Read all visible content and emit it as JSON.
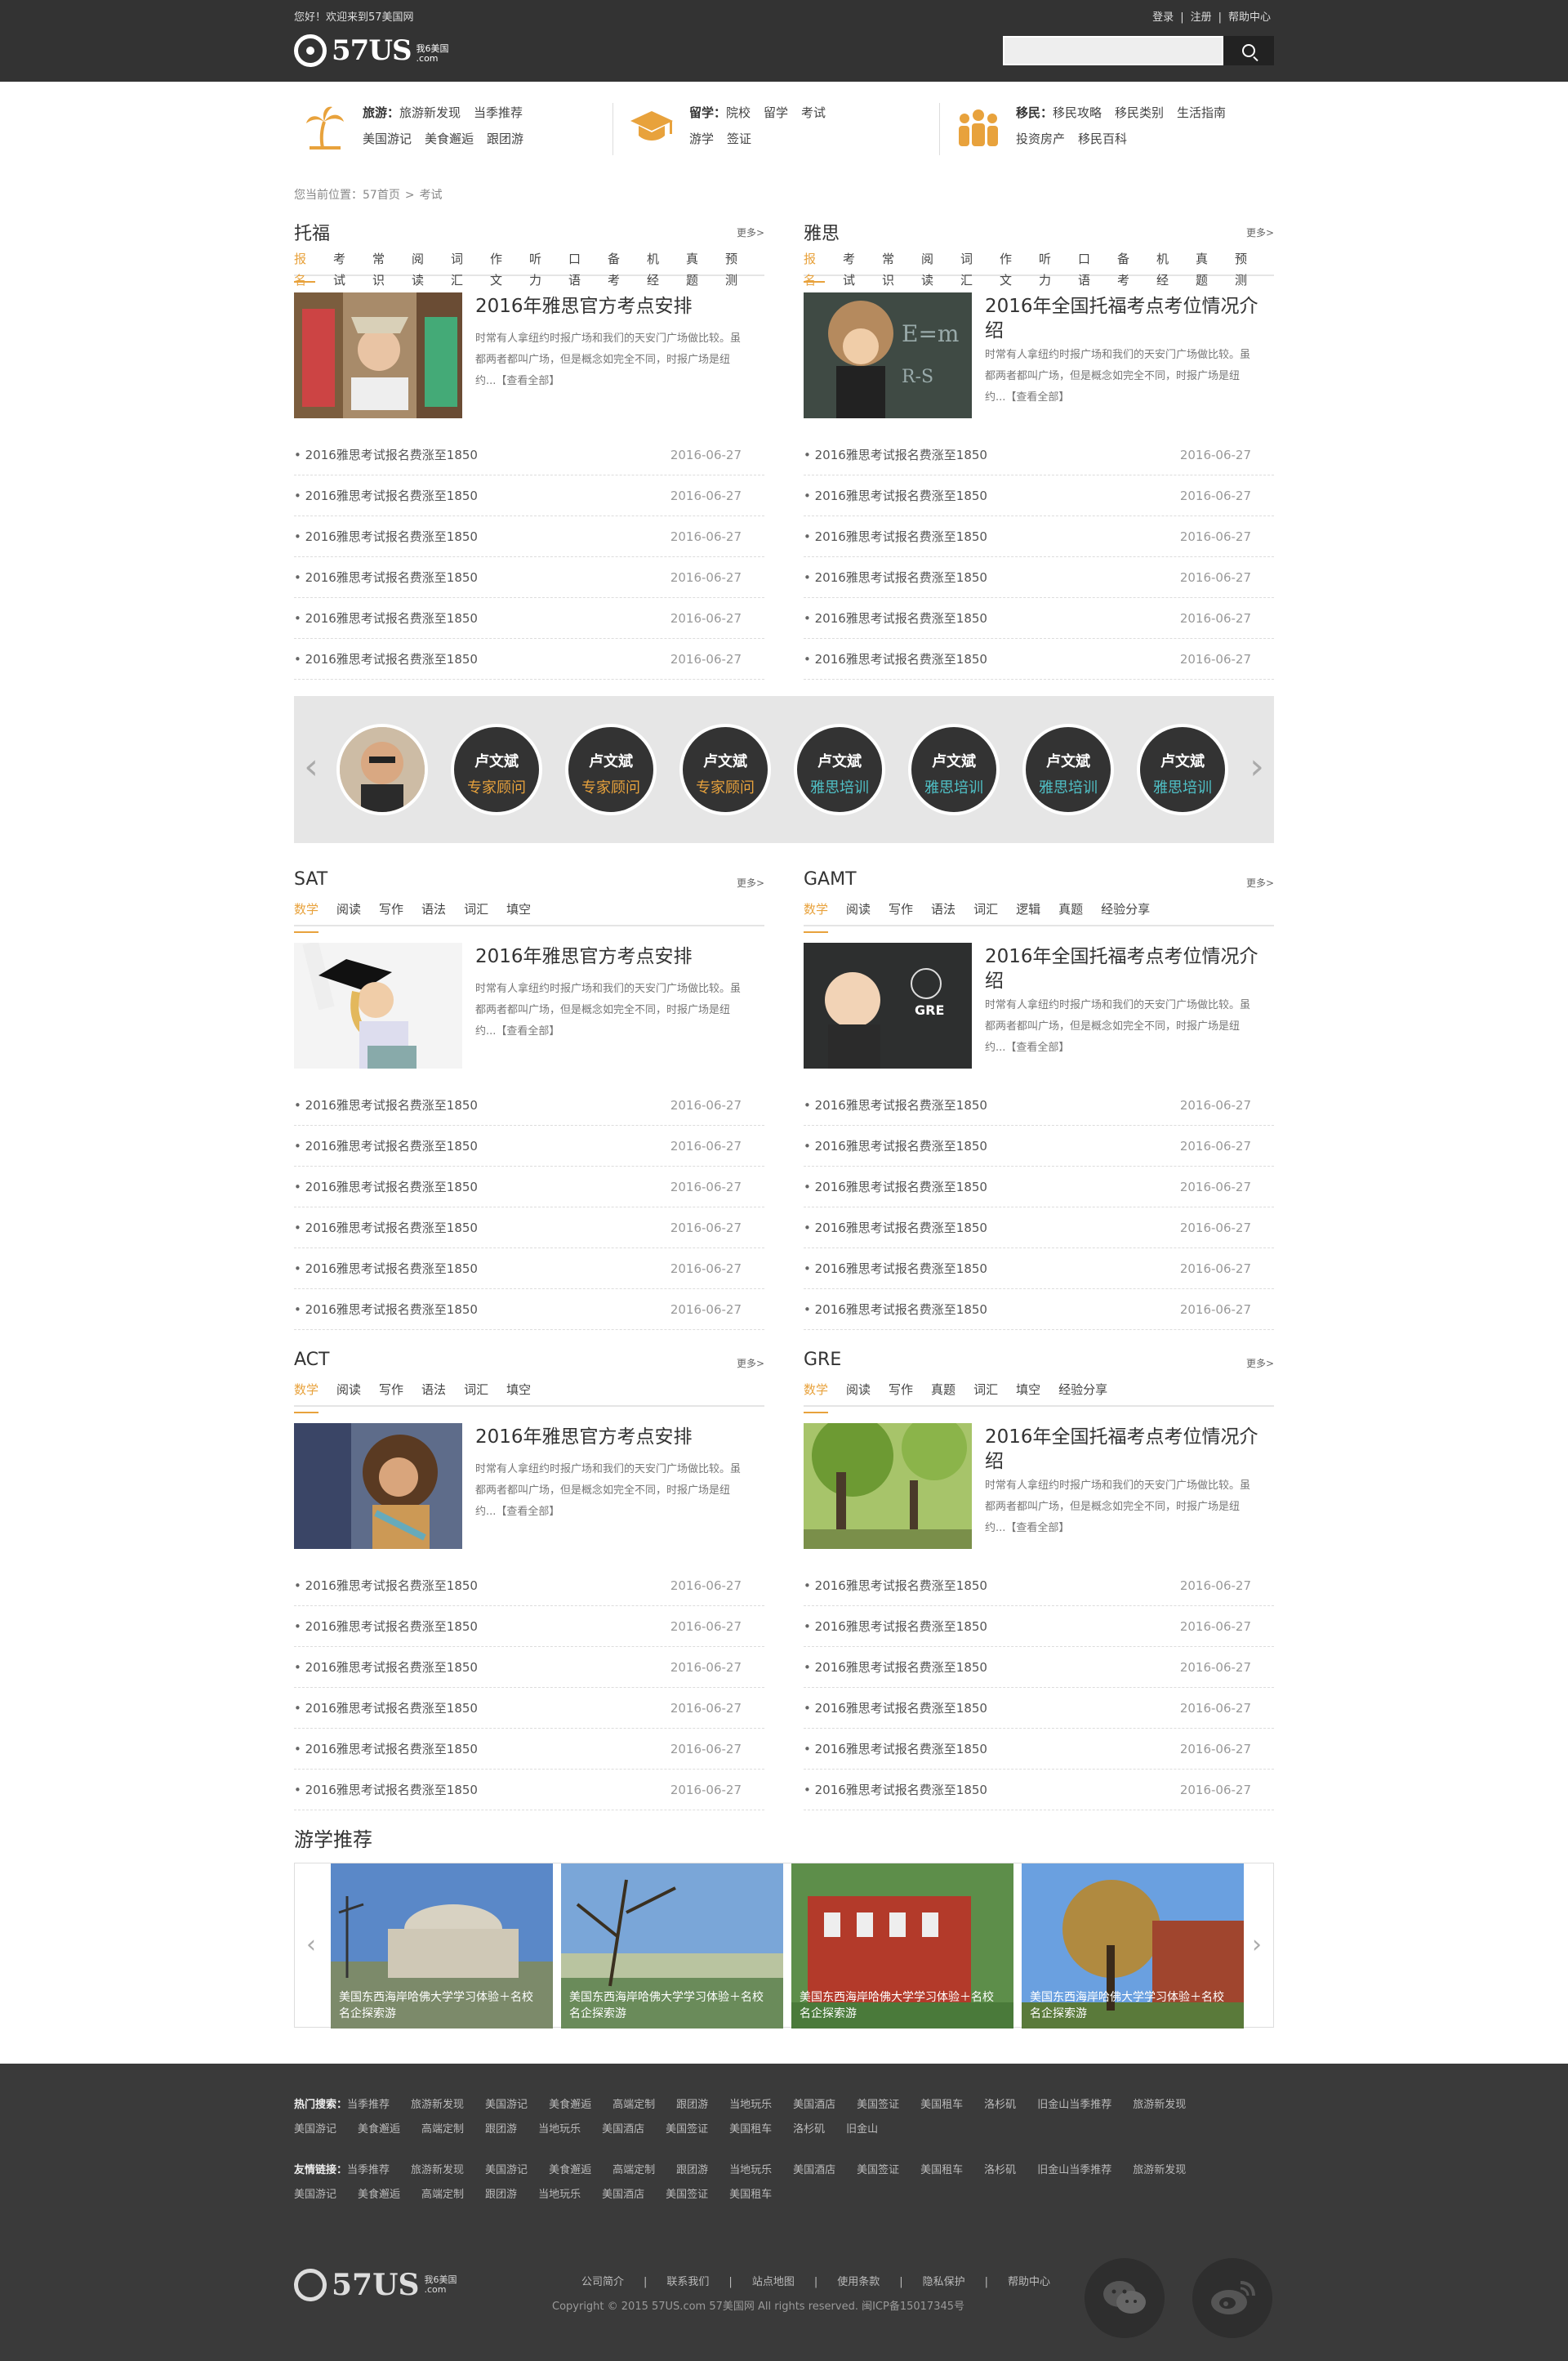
{
  "topbar": {
    "welcome": "您好！欢迎来到57美国网",
    "login": "登录",
    "register": "注册",
    "help": "帮助中心",
    "sep": "|"
  },
  "logo": {
    "text": "57US",
    "sub1": "我6美国",
    "sub2": ".com"
  },
  "search": {
    "placeholder": ""
  },
  "categories": [
    {
      "icon": "palm-tree-icon",
      "title": "旅游：",
      "row1": [
        "旅游新发现",
        "当季推荐"
      ],
      "row2": [
        "美国游记",
        "美食邂逅",
        "跟团游"
      ]
    },
    {
      "icon": "graduation-cap-icon",
      "title": "留学：",
      "row1": [
        "院校",
        "留学",
        "考试"
      ],
      "row2": [
        "游学",
        "签证"
      ]
    },
    {
      "icon": "people-icon",
      "title": "移民：",
      "row1": [
        "移民攻略",
        "移民类别",
        "生活指南"
      ],
      "row2": [
        "投资房产",
        "移民百科"
      ]
    }
  ],
  "breadcrumb": [
    "您当前位置：57首页",
    ">",
    "考试"
  ],
  "news_item": {
    "title": "2016雅思考试报名费涨至1850",
    "date": "2016-06-27"
  },
  "sections": {
    "toefl": {
      "title": "托福",
      "more": "更多>",
      "tabs": [
        "报名",
        "考试",
        "常识",
        "阅读",
        "词汇",
        "作文",
        "听力",
        "口语",
        "备考",
        "机经",
        "真题",
        "预测"
      ],
      "headline": "2016年雅思官方考点安排",
      "summary": "时常有人拿纽约时报广场和我们的天安门广场做比较。虽都两者都叫广场，但是概念如完全不同，时报广场是纽约...【查看全部】"
    },
    "ielts": {
      "title": "雅思",
      "more": "更多>",
      "tabs": [
        "报名",
        "考试",
        "常识",
        "阅读",
        "词汇",
        "作文",
        "听力",
        "口语",
        "备考",
        "机经",
        "真题",
        "预测"
      ],
      "headline": "2016年全国托福考点考位情况介绍",
      "summary": "时常有人拿纽约时报广场和我们的天安门广场做比较。虽都两者都叫广场，但是概念如完全不同，时报广场是纽约...【查看全部】"
    },
    "sat": {
      "title": "SAT",
      "more": "更多>",
      "tabs": [
        "数学",
        "阅读",
        "写作",
        "语法",
        "词汇",
        "填空"
      ],
      "headline": "2016年雅思官方考点安排",
      "summary": "时常有人拿纽约时报广场和我们的天安门广场做比较。虽都两者都叫广场，但是概念如完全不同，时报广场是纽约...【查看全部】"
    },
    "gamt": {
      "title": "GAMT",
      "more": "更多>",
      "tabs": [
        "数学",
        "阅读",
        "写作",
        "语法",
        "词汇",
        "逻辑",
        "真题",
        "经验分享"
      ],
      "headline": "2016年全国托福考点考位情况介绍",
      "summary": "时常有人拿纽约时报广场和我们的天安门广场做比较。虽都两者都叫广场，但是概念如完全不同，时报广场是纽约...【查看全部】",
      "image_text": "GRE"
    },
    "act": {
      "title": "ACT",
      "more": "更多>",
      "tabs": [
        "数学",
        "阅读",
        "写作",
        "语法",
        "词汇",
        "填空"
      ],
      "headline": "2016年雅思官方考点安排",
      "summary": "时常有人拿纽约时报广场和我们的天安门广场做比较。虽都两者都叫广场，但是概念如完全不同，时报广场是纽约...【查看全部】"
    },
    "gre": {
      "title": "GRE",
      "more": "更多>",
      "tabs": [
        "数学",
        "阅读",
        "写作",
        "真题",
        "词汇",
        "填空",
        "经验分享"
      ],
      "headline": "2016年全国托福考点考位情况介绍",
      "summary": "时常有人拿纽约时报广场和我们的天安门广场做比较。虽都两者都叫广场，但是概念如完全不同，时报广场是纽约...【查看全部】"
    }
  },
  "advisors": [
    {
      "name": "",
      "role": ""
    },
    {
      "name": "卢文斌",
      "role": "专家顾问"
    },
    {
      "name": "卢文斌",
      "role": "专家顾问"
    },
    {
      "name": "卢文斌",
      "role": "专家顾问"
    },
    {
      "name": "卢文斌",
      "role": "雅思培训"
    },
    {
      "name": "卢文斌",
      "role": "雅思培训"
    },
    {
      "name": "卢文斌",
      "role": "雅思培训"
    },
    {
      "name": "卢文斌",
      "role": "雅思培训"
    }
  ],
  "travel": {
    "title": "游学推荐",
    "caption": "美国东西海岸哈佛大学学习体验＋名校名企探索游"
  },
  "footer": {
    "hot_label": "热门搜索：",
    "hot_row1": [
      "当季推荐",
      "旅游新发现",
      "美国游记",
      "美食邂逅",
      "高端定制",
      "跟团游",
      "当地玩乐",
      "美国酒店",
      "美国签证",
      "美国租车",
      "洛杉矶",
      "旧金山当季推荐",
      "旅游新发现"
    ],
    "hot_row2": [
      "美国游记",
      "美食邂逅",
      "高端定制",
      "跟团游",
      "当地玩乐",
      "美国酒店",
      "美国签证",
      "美国租车",
      "洛杉矶",
      "旧金山"
    ],
    "friend_label": "友情链接：",
    "friend_row1": [
      "当季推荐",
      "旅游新发现",
      "美国游记",
      "美食邂逅",
      "高端定制",
      "跟团游",
      "当地玩乐",
      "美国酒店",
      "美国签证",
      "美国租车",
      "洛杉矶",
      "旧金山当季推荐",
      "旅游新发现"
    ],
    "friend_row2": [
      "美国游记",
      "美食邂逅",
      "高端定制",
      "跟团游",
      "当地玩乐",
      "美国酒店",
      "美国签证",
      "美国租车"
    ],
    "nav": [
      "公司简介",
      "联系我们",
      "站点地图",
      "使用条款",
      "隐私保护",
      "帮助中心"
    ],
    "copyright": "Copyright © 2015 57US.com 57美国网 All rights reserved. 闽ICP备15017345号"
  },
  "colors": {
    "accent": "#e8a23c",
    "dark": "#333333",
    "footer": "#3a3a3a",
    "gray_band": "#e6e6e6"
  }
}
